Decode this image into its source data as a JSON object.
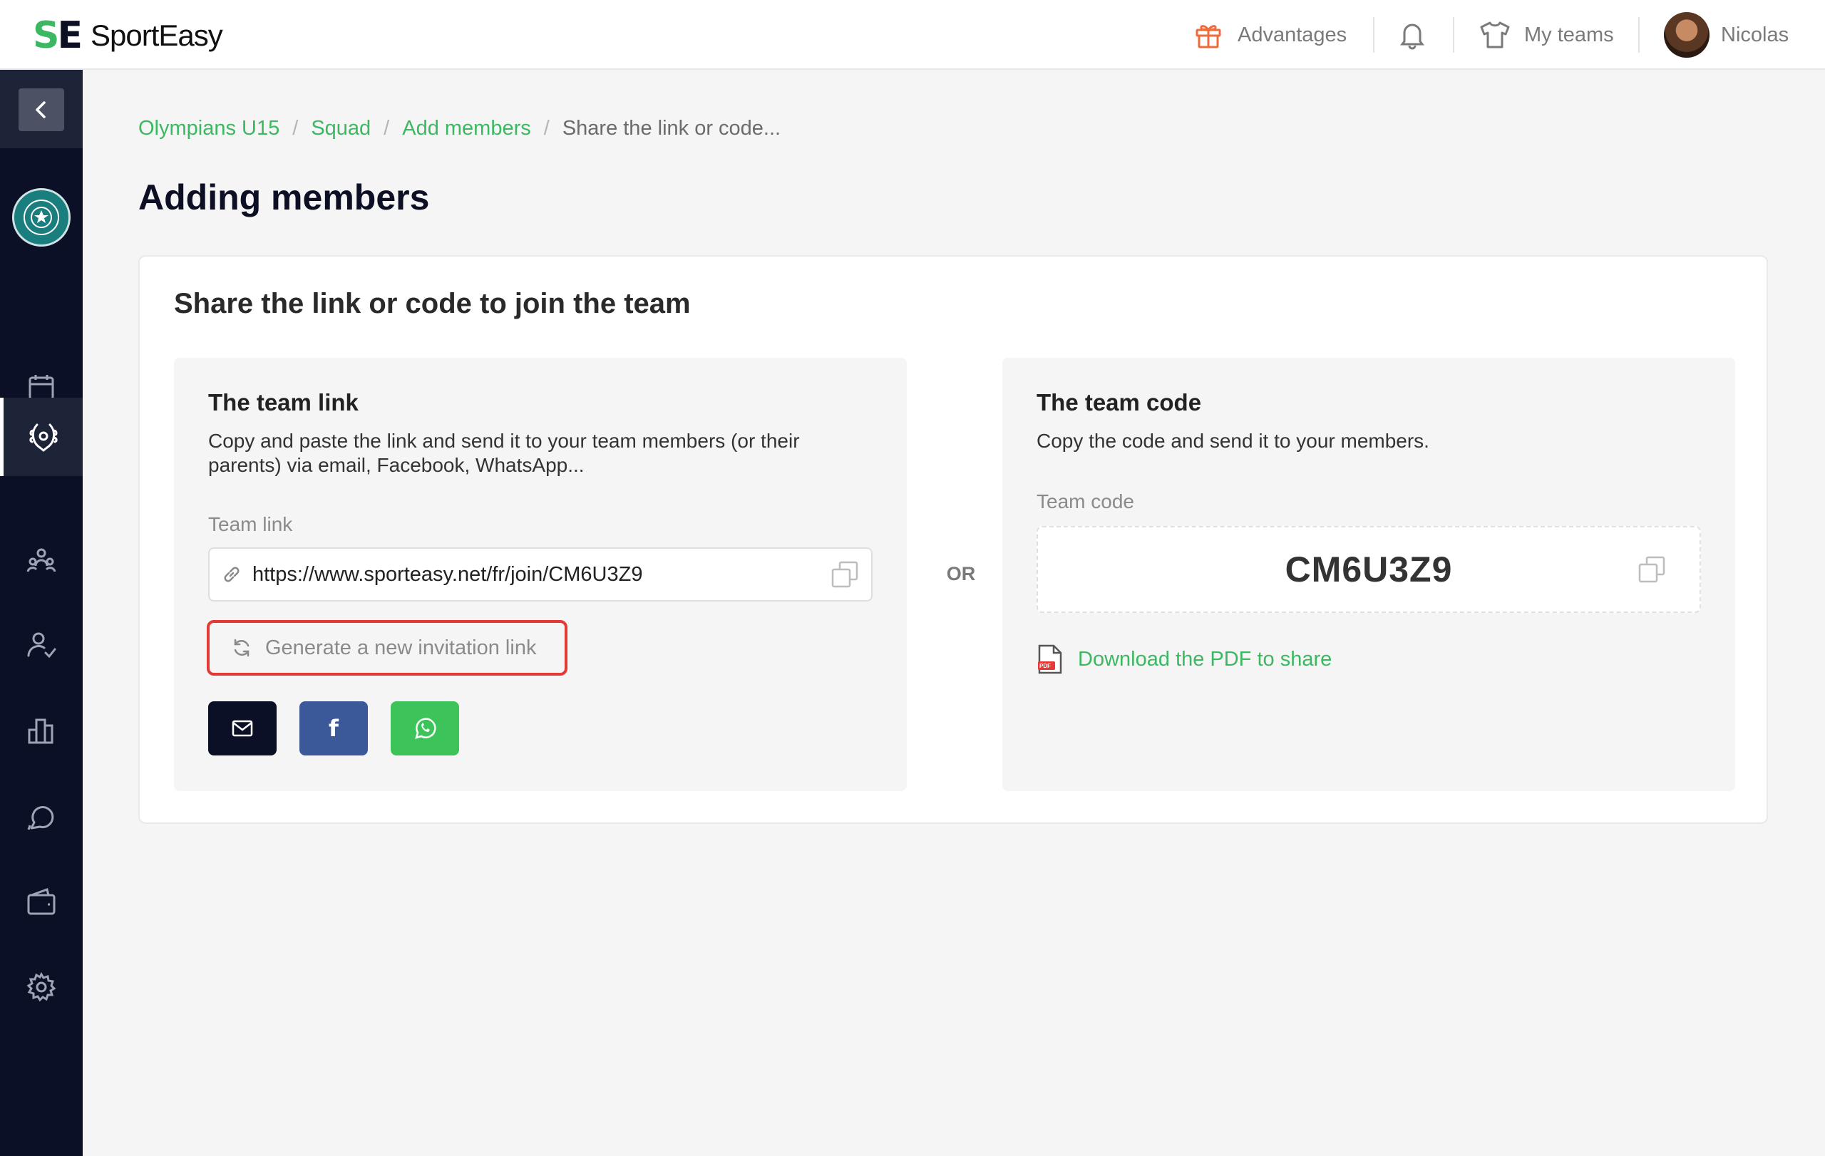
{
  "brand": {
    "mark_s": "S",
    "mark_e": "E",
    "name": "SportEasy"
  },
  "topbar": {
    "advantages_label": "Advantages",
    "my_teams_label": "My teams",
    "user_name": "Nicolas"
  },
  "colors": {
    "accent": "#3cb862",
    "sidebar": "#0b1026",
    "highlight": "#e53935",
    "facebook": "#3b5998",
    "whatsapp": "#3cc45a"
  },
  "sidebar": {
    "items": [
      {
        "name": "calendar-icon"
      },
      {
        "name": "laurel-icon",
        "active": true
      },
      {
        "name": "team-icon"
      },
      {
        "name": "user-check-icon"
      },
      {
        "name": "stats-icon"
      },
      {
        "name": "chat-icon"
      },
      {
        "name": "wallet-icon"
      },
      {
        "name": "gear-icon"
      }
    ]
  },
  "breadcrumb": {
    "items": [
      "Olympians U15",
      "Squad",
      "Add members"
    ],
    "current": "Share the link or code...",
    "separator": "/"
  },
  "page": {
    "title": "Adding members"
  },
  "card": {
    "title": "Share the link or code to join the team",
    "or_label": "OR",
    "link_panel": {
      "title": "The team link",
      "description": "Copy and paste the link and send it to your team members (or their parents) via email, Facebook, WhatsApp...",
      "field_label": "Team link",
      "url": "https://www.sporteasy.net/fr/join/CM6U3Z9",
      "generate_label": "Generate a new invitation link",
      "facebook_glyph": "f"
    },
    "code_panel": {
      "title": "The team code",
      "description": "Copy the code and send it to your members.",
      "field_label": "Team code",
      "code": "CM6U3Z9",
      "pdf_badge": "PDF",
      "pdf_label": "Download the PDF to share"
    }
  }
}
